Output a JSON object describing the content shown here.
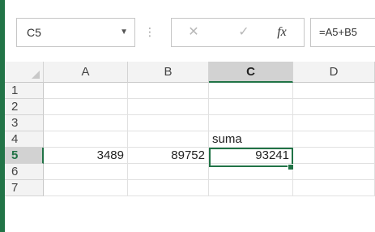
{
  "name_box": {
    "value": "C5",
    "dropdown_icon": "chevron-down-icon"
  },
  "formula_bar": {
    "separator": "⋮",
    "cancel_icon": "✕",
    "enter_icon": "✓",
    "fx_label": "fx",
    "formula": "=A5+B5"
  },
  "columns": [
    "A",
    "B",
    "C",
    "D"
  ],
  "selected_column": "C",
  "rows": [
    "1",
    "2",
    "3",
    "4",
    "5",
    "6",
    "7"
  ],
  "selected_row": "5",
  "cells": {
    "C4": "suma",
    "A5": "3489",
    "B5": "89752",
    "C5": "93241"
  },
  "colors": {
    "accent": "#217346",
    "header_bg": "#f3f3f3",
    "selected_header_bg": "#d2d2d2"
  }
}
